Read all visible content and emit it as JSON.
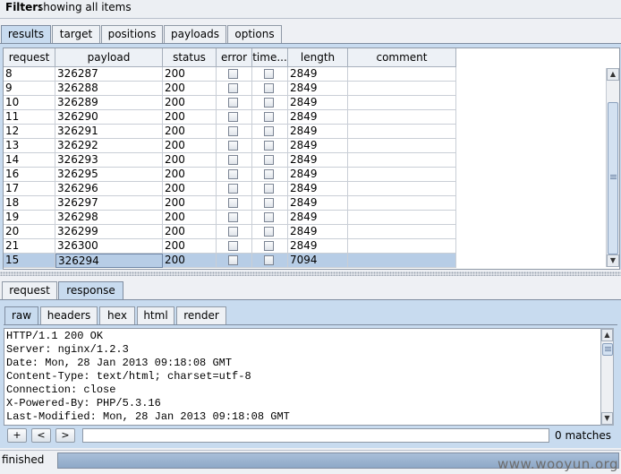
{
  "filter": {
    "label": "Filter:",
    "value": "showing all items"
  },
  "main_tabs": [
    {
      "label": "results",
      "active": true
    },
    {
      "label": "target",
      "active": false
    },
    {
      "label": "positions",
      "active": false
    },
    {
      "label": "payloads",
      "active": false
    },
    {
      "label": "options",
      "active": false
    }
  ],
  "table": {
    "columns": [
      "request",
      "payload",
      "status",
      "error",
      "time...",
      "length",
      "comment"
    ],
    "rows": [
      {
        "request": "8",
        "payload": "326287",
        "status": "200",
        "length": "2849"
      },
      {
        "request": "9",
        "payload": "326288",
        "status": "200",
        "length": "2849"
      },
      {
        "request": "10",
        "payload": "326289",
        "status": "200",
        "length": "2849"
      },
      {
        "request": "11",
        "payload": "326290",
        "status": "200",
        "length": "2849"
      },
      {
        "request": "12",
        "payload": "326291",
        "status": "200",
        "length": "2849"
      },
      {
        "request": "13",
        "payload": "326292",
        "status": "200",
        "length": "2849"
      },
      {
        "request": "14",
        "payload": "326293",
        "status": "200",
        "length": "2849"
      },
      {
        "request": "16",
        "payload": "326295",
        "status": "200",
        "length": "2849"
      },
      {
        "request": "17",
        "payload": "326296",
        "status": "200",
        "length": "2849"
      },
      {
        "request": "18",
        "payload": "326297",
        "status": "200",
        "length": "2849"
      },
      {
        "request": "19",
        "payload": "326298",
        "status": "200",
        "length": "2849"
      },
      {
        "request": "20",
        "payload": "326299",
        "status": "200",
        "length": "2849"
      },
      {
        "request": "21",
        "payload": "326300",
        "status": "200",
        "length": "2849"
      },
      {
        "request": "15",
        "payload": "326294",
        "status": "200",
        "length": "7094",
        "selected": true
      }
    ]
  },
  "detail_tabs": [
    {
      "label": "request",
      "active": false
    },
    {
      "label": "response",
      "active": true
    }
  ],
  "view_tabs": [
    {
      "label": "raw",
      "active": true
    },
    {
      "label": "headers",
      "active": false
    },
    {
      "label": "hex",
      "active": false
    },
    {
      "label": "html",
      "active": false
    },
    {
      "label": "render",
      "active": false
    }
  ],
  "response_lines": [
    "HTTP/1.1 200 OK",
    "Server: nginx/1.2.3",
    "Date: Mon, 28 Jan 2013 09:18:08 GMT",
    "Content-Type: text/html; charset=utf-8",
    "Connection: close",
    "X-Powered-By: PHP/5.3.16",
    "Last-Modified: Mon, 28 Jan 2013 09:18:08 GMT"
  ],
  "search": {
    "buttons": [
      "+",
      "<",
      ">"
    ],
    "value": "",
    "matches": "0 matches"
  },
  "status": {
    "text": "finished",
    "progress": 1.0
  },
  "watermark": "www.wooyun.org",
  "icons": {
    "scroll_up": "triangle-up-icon",
    "scroll_down": "triangle-down-icon"
  }
}
